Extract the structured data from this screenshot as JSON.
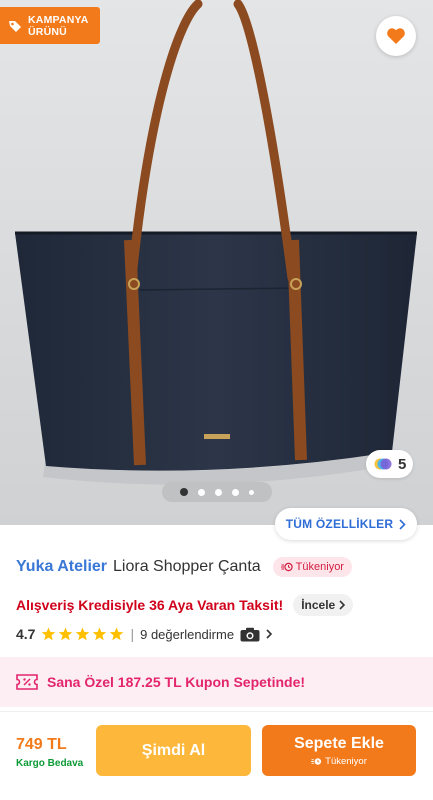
{
  "badge": {
    "line1": "KAMPANYA",
    "line2": "ÜRÜNÜ",
    "icon": "tag-icon"
  },
  "favorite": {
    "icon": "heart-icon",
    "color": "#f27a1a"
  },
  "colors": {
    "count": "5",
    "icon": "color-variants-icon"
  },
  "gallery": {
    "total_dots": 5,
    "active_index": 0
  },
  "features_button": {
    "label": "TÜM ÖZELLİKLER"
  },
  "product": {
    "brand": "Yuka Atelier",
    "name": "Liora Shopper Çanta",
    "stock_badge": "Tükeniyor",
    "credit_text": "Alışveriş Kredisiyle 36 Aya Varan Taksit!",
    "inspect_label": "İncele",
    "rating": "4.7",
    "stars": 5,
    "reviews": "9 değerlendirme"
  },
  "coupon": {
    "text": "Sana Özel 187.25 TL Kupon Sepetinde!"
  },
  "bottom": {
    "price": "749 TL",
    "shipping": "Kargo Bedava",
    "buy_now": "Şimdi Al",
    "add_to_cart": "Sepete Ekle",
    "add_to_cart_sub": "Tükeniyor"
  },
  "theme": {
    "orange": "#f27a1a",
    "yellow": "#fdb83b",
    "blue": "#2e6dd6",
    "red": "#d0021b",
    "pink": "#e3256c",
    "green": "#0c9a36"
  }
}
